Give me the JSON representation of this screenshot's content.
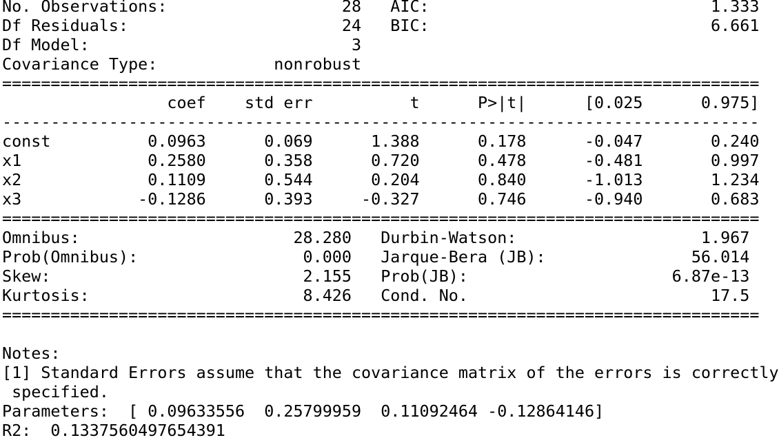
{
  "output": {
    "lines": [
      "No. Observations:                  28   AIC:                             1.333",
      "Df Residuals:                      24   BIC:                             6.661",
      "Df Model:                           3",
      "Covariance Type:            nonrobust",
      "==============================================================================",
      "                 coef    std err          t      P>|t|      [0.025      0.975]",
      "------------------------------------------------------------------------------",
      "const          0.0963      0.069      1.388      0.178      -0.047       0.240",
      "x1             0.2580      0.358      0.720      0.478      -0.481       0.997",
      "x2             0.1109      0.544      0.204      0.840      -1.013       1.234",
      "x3            -0.1286      0.393     -0.327      0.746      -0.940       0.683",
      "==============================================================================",
      "Omnibus:                      28.280   Durbin-Watson:                   1.967",
      "Prob(Omnibus):                 0.000   Jarque-Bera (JB):               56.014",
      "Skew:                          2.155   Prob(JB):                     6.87e-13",
      "Kurtosis:                      8.426   Cond. No.                         17.5",
      "==============================================================================",
      "",
      "Notes:",
      "[1] Standard Errors assume that the covariance matrix of the errors is correctly",
      " specified.",
      "Parameters:  [ 0.09633556  0.25799959  0.11092464 -0.12864146]",
      "R2:  0.1337560497654391"
    ]
  }
}
